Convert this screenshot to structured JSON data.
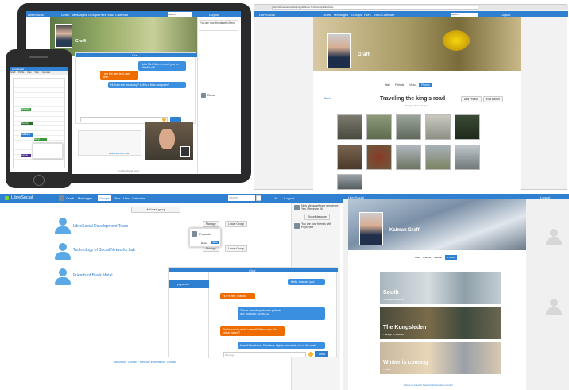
{
  "tablet": {
    "app": "LibreSocial",
    "nav": [
      "Graffi",
      "Messages",
      "Groups",
      "Files",
      "Visio",
      "Calendar"
    ],
    "search": "Search",
    "logout": "Logout",
    "profile_name": "Graffi",
    "notice": "You are now friends with Elena",
    "chat_title": "Chat",
    "msgs": [
      "Hello Mel! Nice to meet you on LibreSocial!",
      "I am the new test user here.",
      "Hi, how are you doing? Is this a Mac computer?",
      "Have you seen the latest pictures?",
      "Can you send me the ones of last Wednesday?"
    ],
    "video_caption": "Bilateral Video Call",
    "footer": "(c) LibreSocial Team",
    "side_user": "Elena"
  },
  "phone": {
    "app": "LibreSocial",
    "nav": [
      "Graffi",
      "Profile",
      "Files",
      "Visio",
      "Calendar"
    ],
    "rows": [
      "Workshop",
      "Meeting",
      "Call Elena",
      "Dinner",
      "Lecture"
    ]
  },
  "browser": {
    "url": "https://libresocial.com/plugins/graffi/index.html#/user/profile/photos",
    "app": "LibreSocial",
    "nav": [
      "Graffi",
      "Messages",
      "Groups",
      "Files",
      "Visio",
      "Calendar"
    ],
    "search": "Search",
    "logout": "Logout",
    "profile_name": "Graffi",
    "tabs": [
      "Wall",
      "Friends",
      "Visio",
      "Photos"
    ],
    "album_title": "Traveling the king's road",
    "album_sub": "Kungsleden in August",
    "back": "Back",
    "add_photos": "Add Photos",
    "edit_album": "Edit Album"
  },
  "main": {
    "app": "LibreSocial",
    "nav": [
      "Graffi",
      "Messages",
      "Groups",
      "Files",
      "Visio",
      "Calendar"
    ],
    "search": "Search",
    "logout": "Logout",
    "user_menu": "All",
    "add_group": "Add new group",
    "groups": [
      "LibreSocial Development Team",
      "Technology of Social Networks Lab",
      "Friends of Black Metal"
    ],
    "accept": "Accept",
    "leave": "Leave Group",
    "manage": "Manage",
    "popup_user": "Peysenier",
    "popup_save": "Save",
    "popup_cancel": "Reset",
    "notif1": "New Message from peysenier: Yes I Received It!",
    "show_msg": "Show Message",
    "notif2": "You are now friends with Peysenier",
    "chat_title": "Chat",
    "chat_user": "peysenier",
    "chat_msgs": [
      "Hello, how are you?",
      "Hi, I'm fine, thanks!",
      "This is one of my favorite pictures",
      "That's exactly what I meant! Where was this picture taken?",
      "Near Kebnekaise, Sweden's highest mountain, far in the north."
    ],
    "chat_times": [
      "just now",
      "just now",
      "just now",
      "just now"
    ],
    "chat_link": "IMG_20160101_123456.jpg",
    "send": "Send",
    "chat_placeholder": "Message",
    "footer": [
      "About us",
      "Contact",
      "Network information",
      "Contact"
    ]
  },
  "right": {
    "app": "LibreSocial",
    "profile_name": "Kalman Graffi",
    "tabs": [
      "Wall",
      "Friends",
      "Kalman",
      "Photos"
    ],
    "albums": [
      {
        "title": "South",
        "sub": "Taraludio Antarctica"
      },
      {
        "title": "The Kungsleden",
        "sub": "Trailsign in Sweden"
      },
      {
        "title": "Winter is coming",
        "sub": "Finland"
      }
    ],
    "footer": "About us  Contact  Network Information  Contact",
    "logout": "Logout"
  },
  "colors": {
    "accent": "#2f80d1",
    "orange": "#ef6c00",
    "nav_bg": "#2f80d1"
  }
}
